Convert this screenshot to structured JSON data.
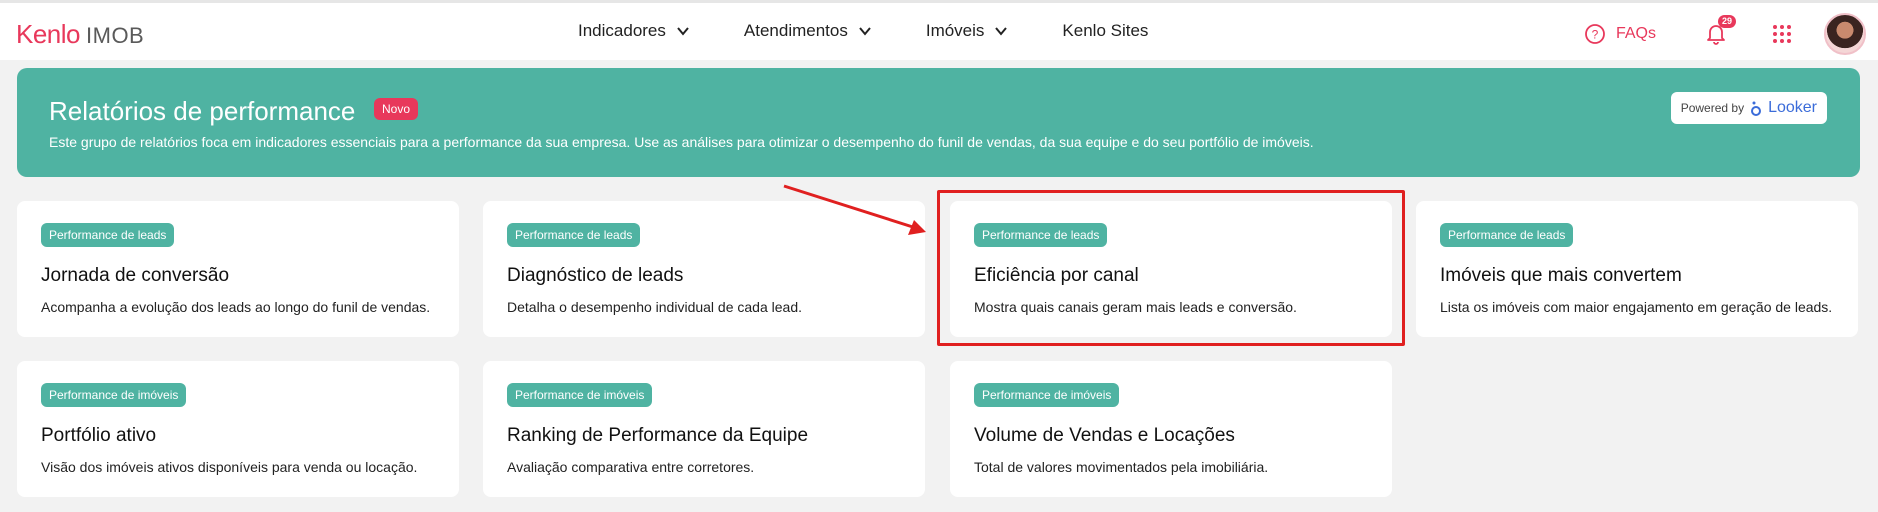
{
  "header": {
    "logo_brand": "Kenlo",
    "logo_product": "IMOB",
    "nav": [
      {
        "label": "Indicadores",
        "has_dropdown": true
      },
      {
        "label": "Atendimentos",
        "has_dropdown": true
      },
      {
        "label": "Imóveis",
        "has_dropdown": true
      },
      {
        "label": "Kenlo Sites",
        "has_dropdown": false
      }
    ],
    "faq_label": "FAQs",
    "notification_count": "29",
    "icons": [
      "question-circle-icon",
      "bell-icon",
      "grid-apps-icon",
      "user-avatar"
    ]
  },
  "banner": {
    "title": "Relatórios de performance",
    "new_badge": "Novo",
    "description": "Este grupo de relatórios foca em indicadores essenciais para a performance da sua empresa. Use as análises para otimizar o desempenho do funil de vendas, da sua equipe e do seu portfólio de imóveis.",
    "powered_by": "Powered by",
    "powered_brand": "Looker"
  },
  "cards": [
    {
      "tag": "Performance de leads",
      "title": "Jornada de conversão",
      "description": "Acompanha a evolução dos leads ao longo do funil de vendas."
    },
    {
      "tag": "Performance de leads",
      "title": "Diagnóstico de leads",
      "description": "Detalha o desempenho individual de cada lead."
    },
    {
      "tag": "Performance de leads",
      "title": "Eficiência por canal",
      "description": "Mostra quais canais geram mais leads e conversão."
    },
    {
      "tag": "Performance de leads",
      "title": "Imóveis que mais convertem",
      "description": "Lista os imóveis com maior engajamento em geração de leads."
    },
    {
      "tag": "Performance de imóveis",
      "title": "Portfólio ativo",
      "description": "Visão dos imóveis ativos disponíveis para venda ou locação."
    },
    {
      "tag": "Performance de imóveis",
      "title": "Ranking de Performance da Equipe",
      "description": "Avaliação comparativa entre corretores."
    },
    {
      "tag": "Performance de imóveis",
      "title": "Volume de Vendas e Locações",
      "description": "Total de valores movimentados pela imobiliária."
    }
  ],
  "colors": {
    "brand": "#e8385b",
    "teal": "#4fb3a2",
    "highlight": "#e02020",
    "background": "#f2f2f2"
  }
}
